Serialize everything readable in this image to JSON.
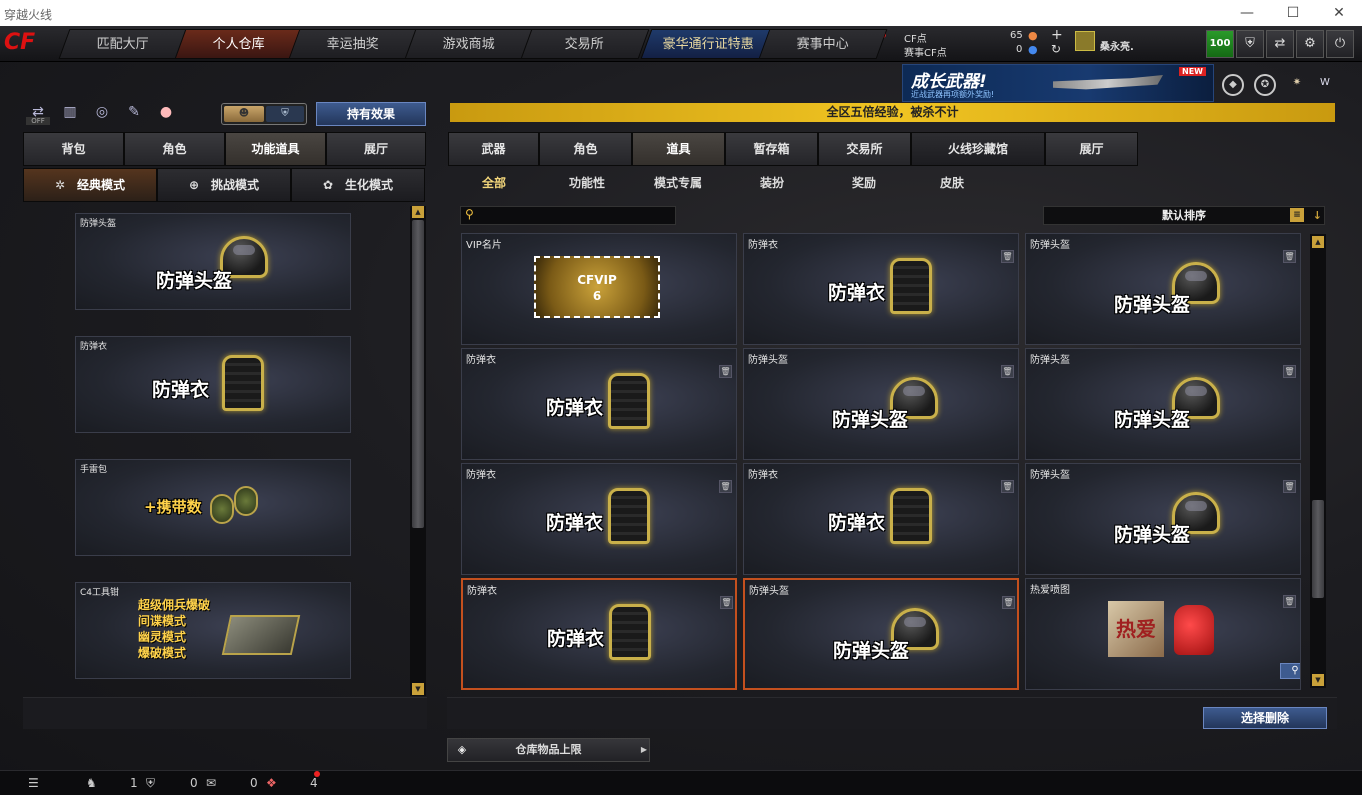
{
  "window": {
    "title": "穿越火线",
    "controls": [
      "—",
      "☐",
      "✕"
    ]
  },
  "nav": {
    "logo": "CF",
    "tabs": [
      "匹配大厅",
      "个人仓库",
      "幸运抽奖",
      "游戏商城",
      "交易所",
      "豪华通行证特惠",
      "赛事中心"
    ],
    "active": 1,
    "cf_label": "CF点",
    "cf_value": "65",
    "event_cf_label": "赛事CF点",
    "event_cf_value": "0",
    "username": "桑永亮.",
    "level": "100",
    "icons": [
      "shield-icon",
      "swap-icon",
      "gear-icon",
      "power-icon"
    ]
  },
  "banner": {
    "title": "成长武器!",
    "subtitle": "近战武器再项额外奖励!",
    "badge": "NEW"
  },
  "left": {
    "toolbar_off": "OFF",
    "effect_button": "持有效果",
    "tabs": [
      "背包",
      "角色",
      "功能道具",
      "展厅"
    ],
    "active_tab": 2,
    "modes": [
      "经典模式",
      "挑战模式",
      "生化模式"
    ],
    "active_mode": 0,
    "items": [
      {
        "category": "防弹头盔",
        "label": "防弹头盔",
        "kind": "helmet"
      },
      {
        "category": "防弹衣",
        "label": "防弹衣",
        "kind": "vest"
      },
      {
        "category": "手雷包",
        "label": "+携带数",
        "kind": "grenade"
      },
      {
        "category": "C4工具钳",
        "lines": [
          "超级佣兵爆破",
          "间谍模式",
          "幽灵模式",
          "爆破模式"
        ],
        "kind": "c4"
      }
    ]
  },
  "right": {
    "notice": "全区五倍经验，被杀不计",
    "tabs": [
      "武器",
      "角色",
      "道具",
      "暂存箱",
      "交易所",
      "火线珍藏馆",
      "展厅"
    ],
    "active_tab": 2,
    "subtabs": [
      "全部",
      "功能性",
      "模式专属",
      "装扮",
      "奖励",
      "皮肤"
    ],
    "active_subtab": 0,
    "search_placeholder": "",
    "sort_label": "默认排序",
    "items": [
      {
        "category": "VIP名片",
        "kind": "vip",
        "vip_text": "CFVIP",
        "vip_level": "6"
      },
      {
        "category": "防弹衣",
        "label": "防弹衣",
        "kind": "vest"
      },
      {
        "category": "防弹头盔",
        "label": "防弹头盔",
        "kind": "helmet"
      },
      {
        "category": "防弹衣",
        "label": "防弹衣",
        "kind": "vest"
      },
      {
        "category": "防弹头盔",
        "label": "防弹头盔",
        "kind": "helmet"
      },
      {
        "category": "防弹头盔",
        "label": "防弹头盔",
        "kind": "helmet"
      },
      {
        "category": "防弹衣",
        "label": "防弹衣",
        "kind": "vest"
      },
      {
        "category": "防弹衣",
        "label": "防弹衣",
        "kind": "vest"
      },
      {
        "category": "防弹头盔",
        "label": "防弹头盔",
        "kind": "helmet"
      },
      {
        "category": "防弹衣",
        "label": "防弹衣",
        "kind": "vest",
        "highlight": true
      },
      {
        "category": "防弹头盔",
        "label": "防弹头盔",
        "kind": "helmet",
        "highlight": true
      },
      {
        "category": "热爱喷图",
        "kind": "spray",
        "spray_text": "热爱"
      }
    ],
    "delete_button": "选择删除",
    "capacity_button": "仓库物品上限"
  },
  "status": {
    "counts": [
      "1",
      "0",
      "0",
      "4"
    ]
  }
}
